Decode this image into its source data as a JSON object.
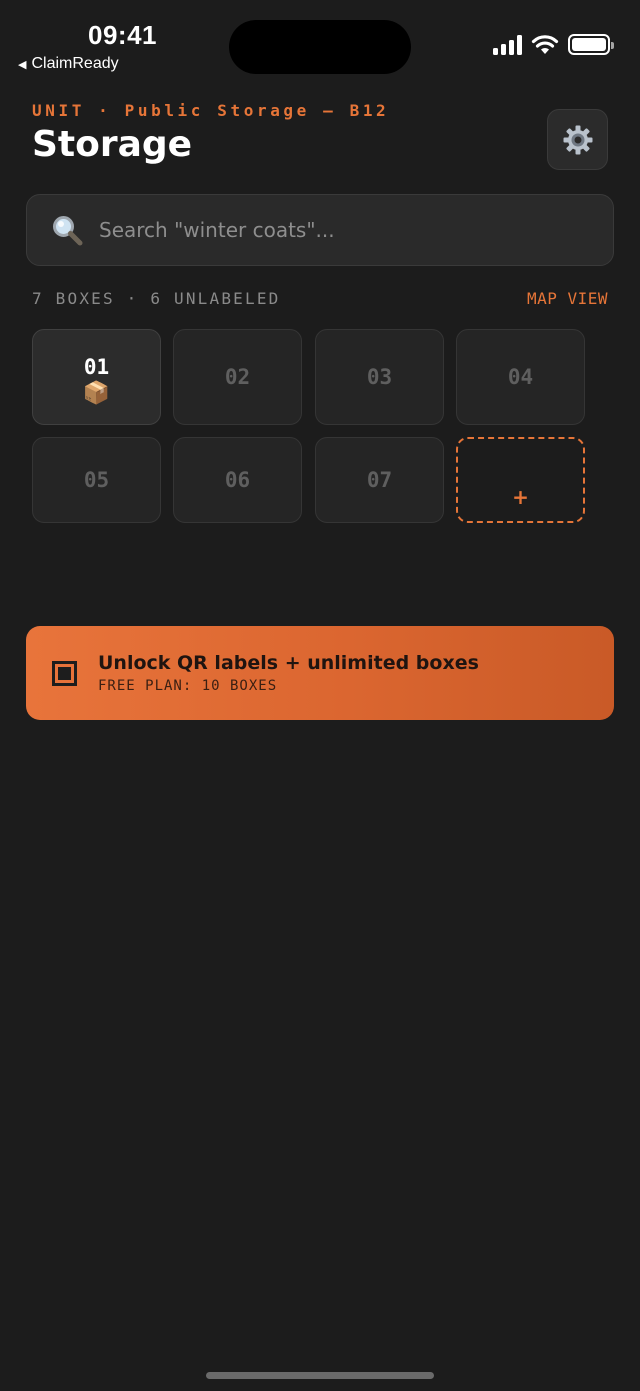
{
  "status_bar": {
    "time": "09:41",
    "back_app": "ClaimReady",
    "back_icon": "back-triangle-icon"
  },
  "header": {
    "unit_line": "UNIT · Public Storage — B12",
    "title": "Storage",
    "settings_icon": "gear-icon"
  },
  "search": {
    "placeholder": "Search \"winter coats\"...",
    "value": ""
  },
  "summary": {
    "count_line": "7 BOXES · 6 UNLABELED",
    "map_view_label": "MAP VIEW"
  },
  "boxes": [
    {
      "number": "01",
      "labeled": true,
      "emoji": "📦"
    },
    {
      "number": "02",
      "labeled": false
    },
    {
      "number": "03",
      "labeled": false
    },
    {
      "number": "04",
      "labeled": false
    },
    {
      "number": "05",
      "labeled": false
    },
    {
      "number": "06",
      "labeled": false
    },
    {
      "number": "07",
      "labeled": false
    }
  ],
  "add_box": {
    "label": "+"
  },
  "upgrade_banner": {
    "title": "Unlock QR labels + unlimited boxes",
    "subtitle": "FREE PLAN: 10 BOXES",
    "icon": "qr-icon"
  },
  "colors": {
    "background": "#1c1c1c",
    "accent": "#e67538",
    "card": "#252525",
    "muted_text": "#8a8a8a"
  }
}
